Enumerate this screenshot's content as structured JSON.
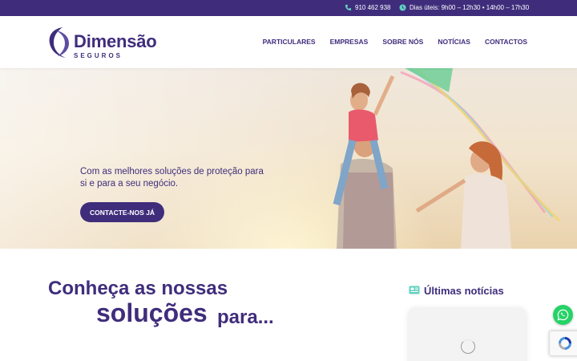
{
  "topbar": {
    "phone": "910 462 938",
    "hours": "Dias úteis: 9h00 – 12h30 • 14h00 – 17h30"
  },
  "brand": {
    "name": "Dimensão",
    "sub": "SEGUROS"
  },
  "nav": {
    "items": [
      "PARTICULARES",
      "EMPRESAS",
      "SOBRE NÓS",
      "NOTÍCIAS",
      "CONTACTOS"
    ]
  },
  "hero": {
    "tagline": "Com as melhores soluções de proteção para si e para a seu negócio.",
    "cta": "CONTACTE-NOS JÁ"
  },
  "solutions": {
    "line1": "Conheça as nossas",
    "highlight": "soluções",
    "suffix": "para..."
  },
  "news": {
    "title": "Últimas notícias"
  },
  "colors": {
    "primary": "#3f2d7c",
    "accent": "#5fd0c0",
    "whatsapp": "#25d366"
  },
  "icons": [
    "phone-icon",
    "clock-icon",
    "news-icon",
    "whatsapp-icon",
    "recaptcha-icon",
    "loading-spinner-icon"
  ]
}
